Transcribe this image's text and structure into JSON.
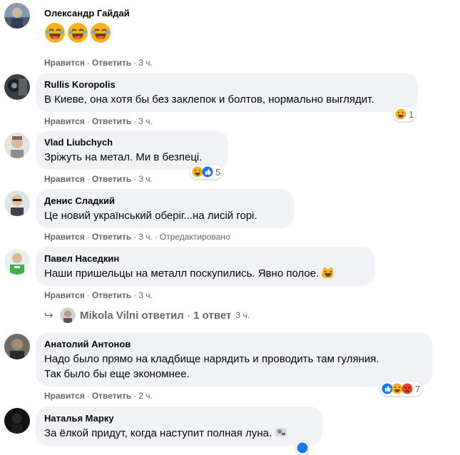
{
  "labels": {
    "like": "Нравится",
    "reply": "Ответить",
    "dot": "·"
  },
  "comments": [
    {
      "author": "Олександр Гайдай",
      "text": "",
      "time": "3 ч.",
      "edited": "",
      "reactions": ""
    },
    {
      "author": "Rullis Koropolis",
      "text": "В Киеве, она хотя бы без заклепок и болтов, нормально выглядит.",
      "time": "3 ч.",
      "edited": "",
      "reactions": "1"
    },
    {
      "author": "Vlad Liubchych",
      "text": "Зріжуть на метал. Ми в безпеці.",
      "time": "3 ч.",
      "edited": "",
      "reactions": "5"
    },
    {
      "author": "Денис Сладкий",
      "text": "Це новий український оберіг...на лисій горі.",
      "time": "3 ч.",
      "edited": "Отредактировано",
      "reactions": ""
    },
    {
      "author": "Павел Наседкин",
      "text": "Наши пришельцы на металл поскупились. Явно полое.",
      "time": "3 ч.",
      "edited": "",
      "reactions": ""
    },
    {
      "author": "Анатолий Антонов",
      "text": "Надо было прямо на кладбище нарядить и проводить там гуляния.",
      "text2": "Так было бы еще экономнее.",
      "time": "2 ч.",
      "edited": "",
      "reactions": "7"
    },
    {
      "author": "Наталья Марку",
      "text": "За ёлкой придут, когда наступит полная луна.",
      "time": "",
      "edited": "",
      "reactions": ""
    }
  ],
  "reply_thread": {
    "author": "Mikola Vilni",
    "verb": "ответил",
    "count": "1 ответ",
    "time": "3 ч."
  },
  "icons": [
    "laughing-emoji",
    "like-reaction",
    "angry-reaction",
    "wow-reaction",
    "reply-arrow-icon"
  ],
  "colors": {
    "bubble": "#f0f2f5",
    "meta": "#65676b",
    "like_blue": "#1877f2",
    "emoji_yellow": "#f7b125"
  }
}
